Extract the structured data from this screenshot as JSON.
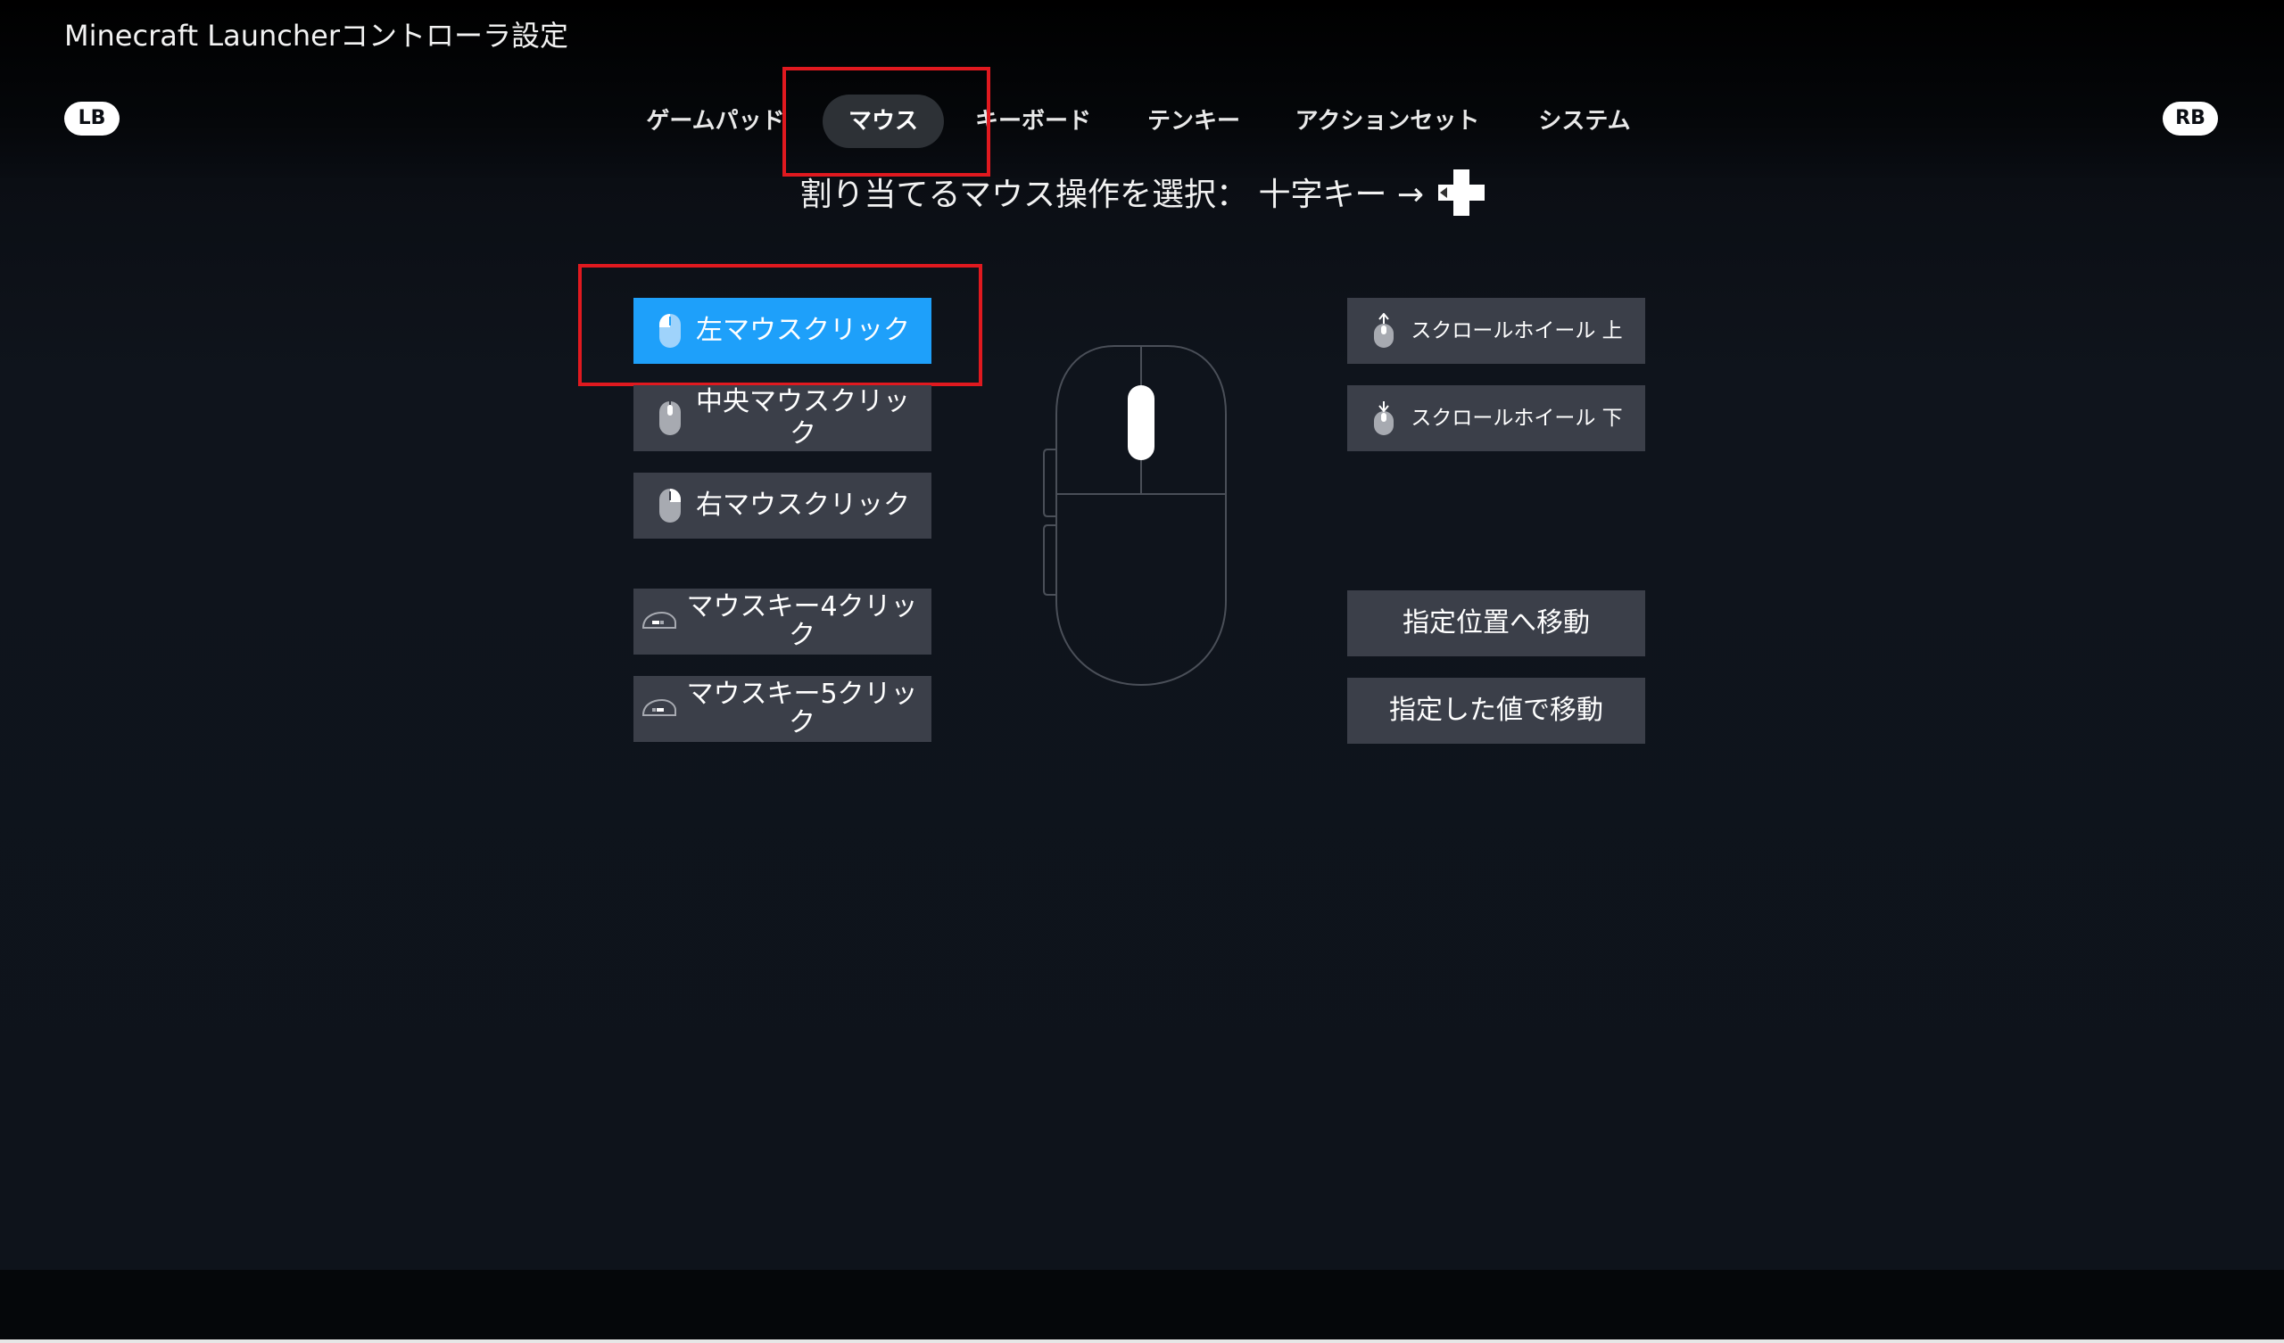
{
  "window": {
    "title": "Minecraft Launcherコントローラ設定"
  },
  "bumpers": {
    "left": "LB",
    "right": "RB"
  },
  "tabs": [
    {
      "label": "ゲームパッド",
      "active": false
    },
    {
      "label": "マウス",
      "active": true
    },
    {
      "label": "キーボード",
      "active": false
    },
    {
      "label": "テンキー",
      "active": false
    },
    {
      "label": "アクションセット",
      "active": false
    },
    {
      "label": "システム",
      "active": false
    }
  ],
  "prompt": {
    "text": "割り当てるマウス操作を選択： 十字キー →",
    "icon": "dpad-icon"
  },
  "left_buttons": [
    {
      "label": "左マウスクリック",
      "icon": "mouse-left-click-icon",
      "selected": true
    },
    {
      "label": "中央マウスクリック",
      "icon": "mouse-middle-click-icon",
      "selected": false
    },
    {
      "label": "右マウスクリック",
      "icon": "mouse-right-click-icon",
      "selected": false
    },
    {
      "label": "マウスキー4クリック",
      "icon": "mouse-side-button-icon",
      "selected": false
    },
    {
      "label": "マウスキー5クリック",
      "icon": "mouse-side-button-icon",
      "selected": false
    }
  ],
  "right_buttons": [
    {
      "label": "スクロールホイール 上",
      "icon": "scroll-up-icon"
    },
    {
      "label": "スクロールホイール 下",
      "icon": "scroll-down-icon"
    },
    {
      "label": "指定位置へ移動",
      "icon": ""
    },
    {
      "label": "指定した値で移動",
      "icon": ""
    }
  ],
  "colors": {
    "selected": "#1ea0fa",
    "button": "#3b3f49",
    "highlight": "#e0191f",
    "background": "#0e131b"
  }
}
